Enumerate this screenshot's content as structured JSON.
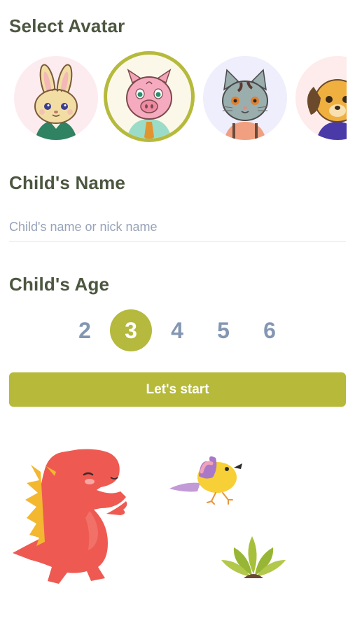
{
  "avatar_section": {
    "title": "Select Avatar",
    "avatars": [
      {
        "icon": "bunny-avatar-icon",
        "bg": "#fcecef",
        "selected": false
      },
      {
        "icon": "pig-avatar-icon",
        "bg": "#fbf8e9",
        "selected": true
      },
      {
        "icon": "cat-avatar-icon",
        "bg": "#eeeefc",
        "selected": false
      },
      {
        "icon": "dog-avatar-icon",
        "bg": "#fdeceb",
        "selected": false
      }
    ]
  },
  "name_section": {
    "title": "Child's Name",
    "placeholder": "Child's name or nick name",
    "value": ""
  },
  "age_section": {
    "title": "Child's Age",
    "options": [
      "2",
      "3",
      "4",
      "5",
      "6"
    ],
    "selected": "3"
  },
  "start_button": {
    "label": "Let's start"
  },
  "decorations": {
    "icons": [
      "dinosaur-icon",
      "bird-icon",
      "plant-icon"
    ]
  },
  "colors": {
    "accent": "#b6b93a",
    "title": "#4c5640",
    "age_text": "#8396b2",
    "placeholder": "#97a3b8"
  }
}
